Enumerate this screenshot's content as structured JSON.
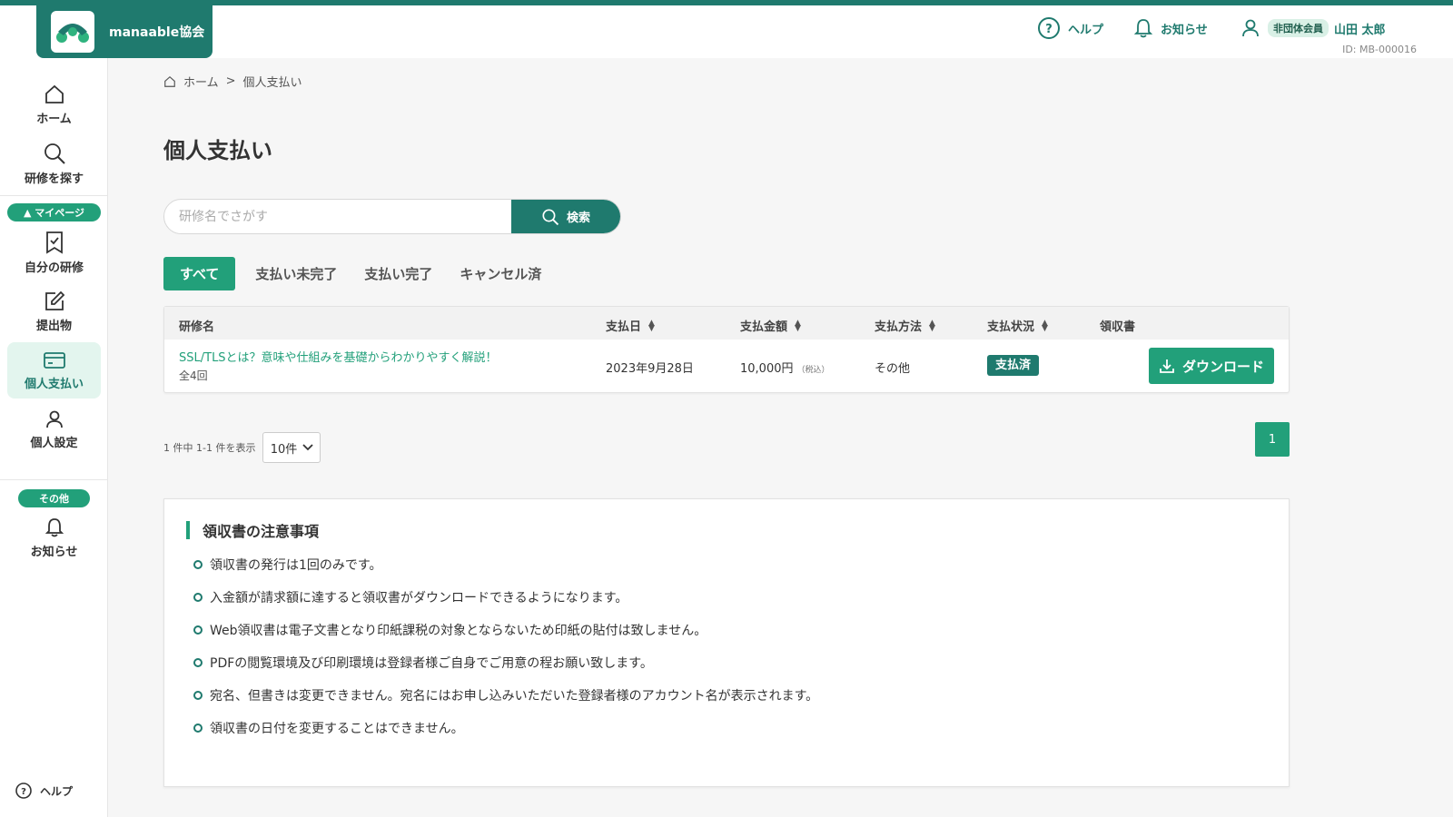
{
  "header": {
    "org_name": "manaable協会",
    "help_label": "ヘルプ",
    "notice_label": "お知らせ",
    "member_badge": "非団体会員",
    "user_name": "山田 太郎",
    "user_id": "ID: MB-000016"
  },
  "sidebar": {
    "home": "ホーム",
    "search": "研修を探す",
    "mypage_pill": "▲ マイページ",
    "my_training": "自分の研修",
    "submissions": "提出物",
    "payments": "個人支払い",
    "settings": "個人設定",
    "other_pill": "その他",
    "notices": "お知らせ",
    "help": "ヘルプ"
  },
  "breadcrumb": {
    "home": "ホーム",
    "sep": ">",
    "current": "個人支払い"
  },
  "page": {
    "title": "個人支払い"
  },
  "search": {
    "placeholder": "研修名でさがす",
    "button": "検索"
  },
  "tabs": [
    "すべて",
    "支払い未完了",
    "支払い完了",
    "キャンセル済"
  ],
  "table": {
    "headers": {
      "name": "研修名",
      "date": "支払日",
      "amount": "支払金額",
      "method": "支払方法",
      "status": "支払状況",
      "receipt": "領収書"
    },
    "rows": [
      {
        "name": "SSL/TLSとは？意味や仕組みを基礎からわかりやすく解説！",
        "sessions": "全4回",
        "date": "2023年9月28日",
        "amount": "10,000円",
        "tax": "（税込）",
        "method": "その他",
        "status": "支払済",
        "receipt_button": "ダウンロード"
      }
    ]
  },
  "pagination": {
    "info": "1 件中 1-1  件を表示",
    "per_page": "10件",
    "current_page": "1"
  },
  "notes": {
    "title": "領収書の注意事項",
    "items": [
      "領収書の発行は1回のみです。",
      "入金額が請求額に達すると領収書がダウンロードできるようになります。",
      "Web領収書は電子文書となり印紙課税の対象とならないため印紙の貼付は致しません。",
      "PDFの閲覧環境及び印刷環境は登録者様ご自身でご用意の程お願い致します。",
      "宛名、但書きは変更できません。宛名にはお申し込みいただいた登録者様のアカウント名が表示されます。",
      "領収書の日付を変更することはできません。"
    ]
  },
  "colors": {
    "brand": "#1f7a6e",
    "accent": "#22a07a",
    "active_bg": "#e3f5ee"
  }
}
